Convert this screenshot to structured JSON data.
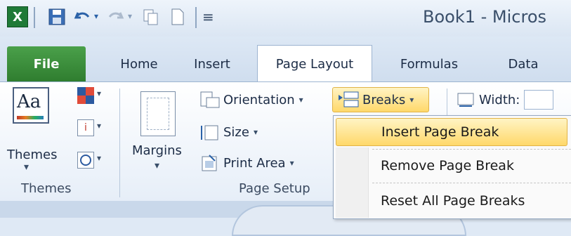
{
  "window": {
    "title": "Book1  -  Micros"
  },
  "tabs": {
    "file": "File",
    "home": "Home",
    "insert": "Insert",
    "page_layout": "Page Layout",
    "formulas": "Formulas",
    "data": "Data"
  },
  "ribbon": {
    "themes_button": "Themes",
    "themes_group": "Themes",
    "margins_button": "Margins",
    "orientation_button": "Orientation",
    "size_button": "Size",
    "print_area_button": "Print Area",
    "breaks_button": "Breaks",
    "page_setup_group": "Page Setup",
    "width_label": "Width:"
  },
  "breaks_menu": {
    "items": [
      "Insert Page Break",
      "Remove Page Break",
      "Reset All Page Breaks"
    ]
  },
  "colors": {
    "file_tab": "#3c8f3c",
    "accent": "#2b62a8",
    "menu_highlight": "#ffe08a"
  }
}
